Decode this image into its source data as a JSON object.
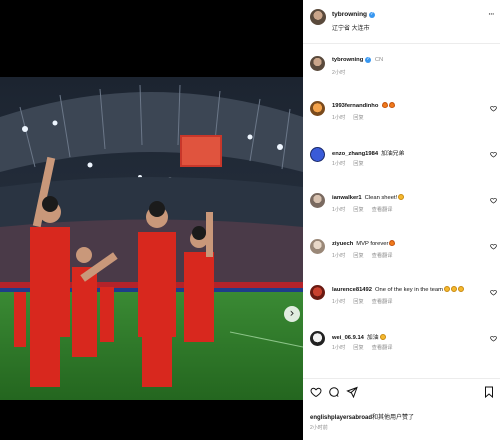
{
  "post": {
    "username": "tybrowning",
    "location": "辽宁省 大连市",
    "caption_badge": "CN",
    "caption_time": "2小时"
  },
  "comments": [
    {
      "user": "1993fernandinho",
      "text": "",
      "emojis": [
        "fire",
        "fire"
      ],
      "time": "1小时",
      "reply": "回复",
      "translate": ""
    },
    {
      "user": "enzo_zhang1984",
      "text": "加油兄弟",
      "emojis": [],
      "time": "1小时",
      "reply": "回复",
      "translate": ""
    },
    {
      "user": "ianwalker1",
      "text": "Clean sheet!",
      "emojis": [
        "thumb"
      ],
      "time": "1小时",
      "reply": "回复",
      "translate": "查看翻译"
    },
    {
      "user": "ziyuech",
      "text": "MVP forever",
      "emojis": [
        "fire"
      ],
      "time": "1小时",
      "reply": "回复",
      "translate": "查看翻译"
    },
    {
      "user": "laurence81492",
      "text": "One of the key in the team",
      "emojis": [
        "clap",
        "clap",
        "clap"
      ],
      "time": "1小时",
      "reply": "回复",
      "translate": "查看翻译"
    },
    {
      "user": "wei_06.9.14",
      "text": "加油",
      "emojis": [
        "muscle"
      ],
      "time": "1小时",
      "reply": "回复",
      "translate": "查看翻译"
    }
  ],
  "footer": {
    "likes_user": "englishplayersabroad",
    "likes_suffix": "和其他用户赞了",
    "time": "2小时前"
  },
  "icons": {
    "verified": "verified-badge-icon",
    "more": "more-options-icon",
    "like": "heart-icon",
    "comment": "comment-icon",
    "share": "share-icon",
    "save": "bookmark-icon",
    "next": "chevron-right-icon"
  },
  "colors": {
    "jersey": "#d8281e",
    "pitch": "#2f7d2c",
    "verified": "#3897f0",
    "meta_gray": "#8e8e8e"
  }
}
